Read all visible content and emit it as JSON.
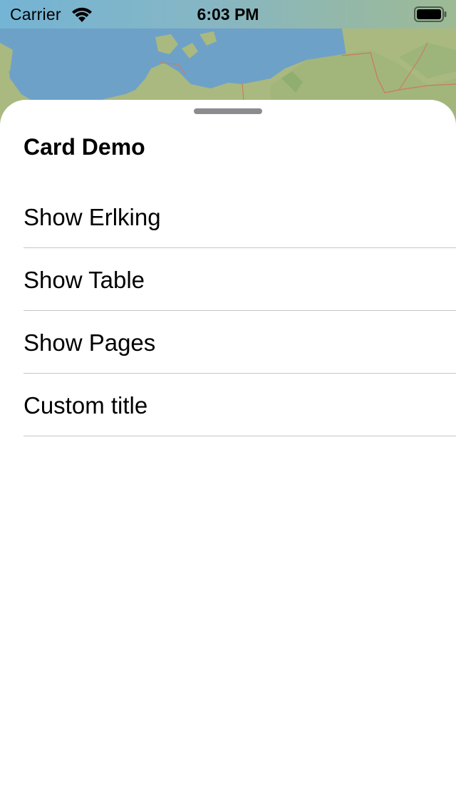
{
  "status_bar": {
    "carrier": "Carrier",
    "time": "6:03 PM",
    "wifi_icon": "wifi-icon",
    "battery_icon": "battery-full-icon"
  },
  "card": {
    "title": "Card Demo",
    "items": [
      {
        "label": "Show Erlking"
      },
      {
        "label": "Show Table"
      },
      {
        "label": "Show Pages"
      },
      {
        "label": "Custom title"
      }
    ]
  },
  "colors": {
    "water": "#6fa0c8",
    "land": "#a6b77e",
    "separator": "#c6c6c8",
    "grabber": "#8b8b90"
  }
}
